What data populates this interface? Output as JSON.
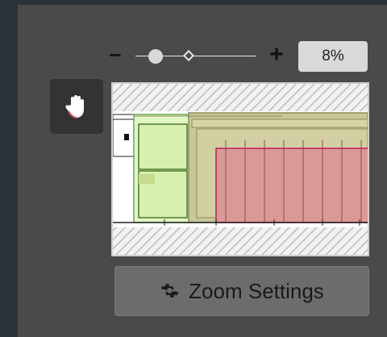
{
  "zoom": {
    "minus_label": "−",
    "plus_label": "+",
    "value_text": "8%",
    "level_fraction": 0.08
  },
  "tools": {
    "hand_icon": "hand-icon"
  },
  "preview": {
    "description_icon": "canvas-thumbnail"
  },
  "settings": {
    "button_label": "Zoom Settings",
    "icon": "gear-icon"
  },
  "colors": {
    "panel": "#4a4a4a",
    "zoom_value_bg": "#d9d9d9",
    "settings_button_bg": "#6c6c6c"
  }
}
